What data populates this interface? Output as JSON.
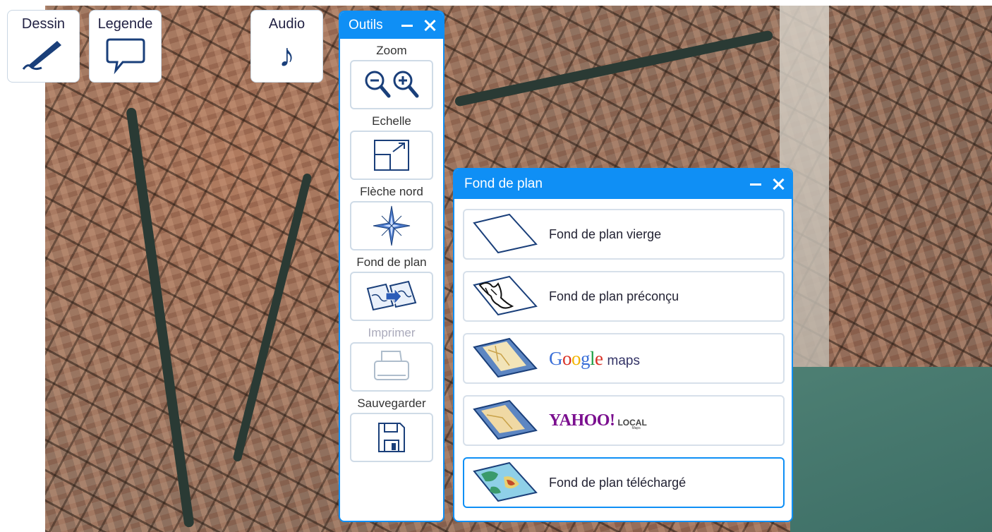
{
  "tools": {
    "dessin": "Dessin",
    "legende": "Legende",
    "audio": "Audio",
    "audio_glyph": "♪"
  },
  "outils": {
    "title": "Outils",
    "sections": {
      "zoom": "Zoom",
      "echelle": "Echelle",
      "fleche_nord": "Flèche nord",
      "fond_de_plan": "Fond de plan",
      "imprimer": "Imprimer",
      "sauvegarder": "Sauvegarder"
    },
    "imprimer_disabled": true
  },
  "fond_de_plan": {
    "title": "Fond de plan",
    "items": [
      {
        "label": "Fond de plan vierge"
      },
      {
        "label": "Fond de plan préconçu"
      },
      {
        "label_google": [
          "G",
          "o",
          "o",
          "g",
          "l",
          "e"
        ],
        "label_maps": "maps"
      },
      {
        "label_yahoo": "YAHOO!",
        "label_local": "LOCAL",
        "label_local_sub": "Maps"
      },
      {
        "label": "Fond de plan téléchargé",
        "selected": true
      }
    ]
  },
  "colors": {
    "accent": "#0f8ff5",
    "google": [
      "#3a6fd8",
      "#d93025",
      "#f2b400",
      "#3a6fd8",
      "#1e9e43",
      "#d93025"
    ],
    "yahoo": "#7b0f8f"
  },
  "icons": [
    "pen-icon",
    "speech-bubble-icon",
    "music-note-icon",
    "zoom-out-icon",
    "zoom-in-icon",
    "scale-icon",
    "compass-rose-icon",
    "base-map-switch-icon",
    "printer-icon",
    "floppy-disk-icon",
    "minimize-icon",
    "close-icon"
  ]
}
